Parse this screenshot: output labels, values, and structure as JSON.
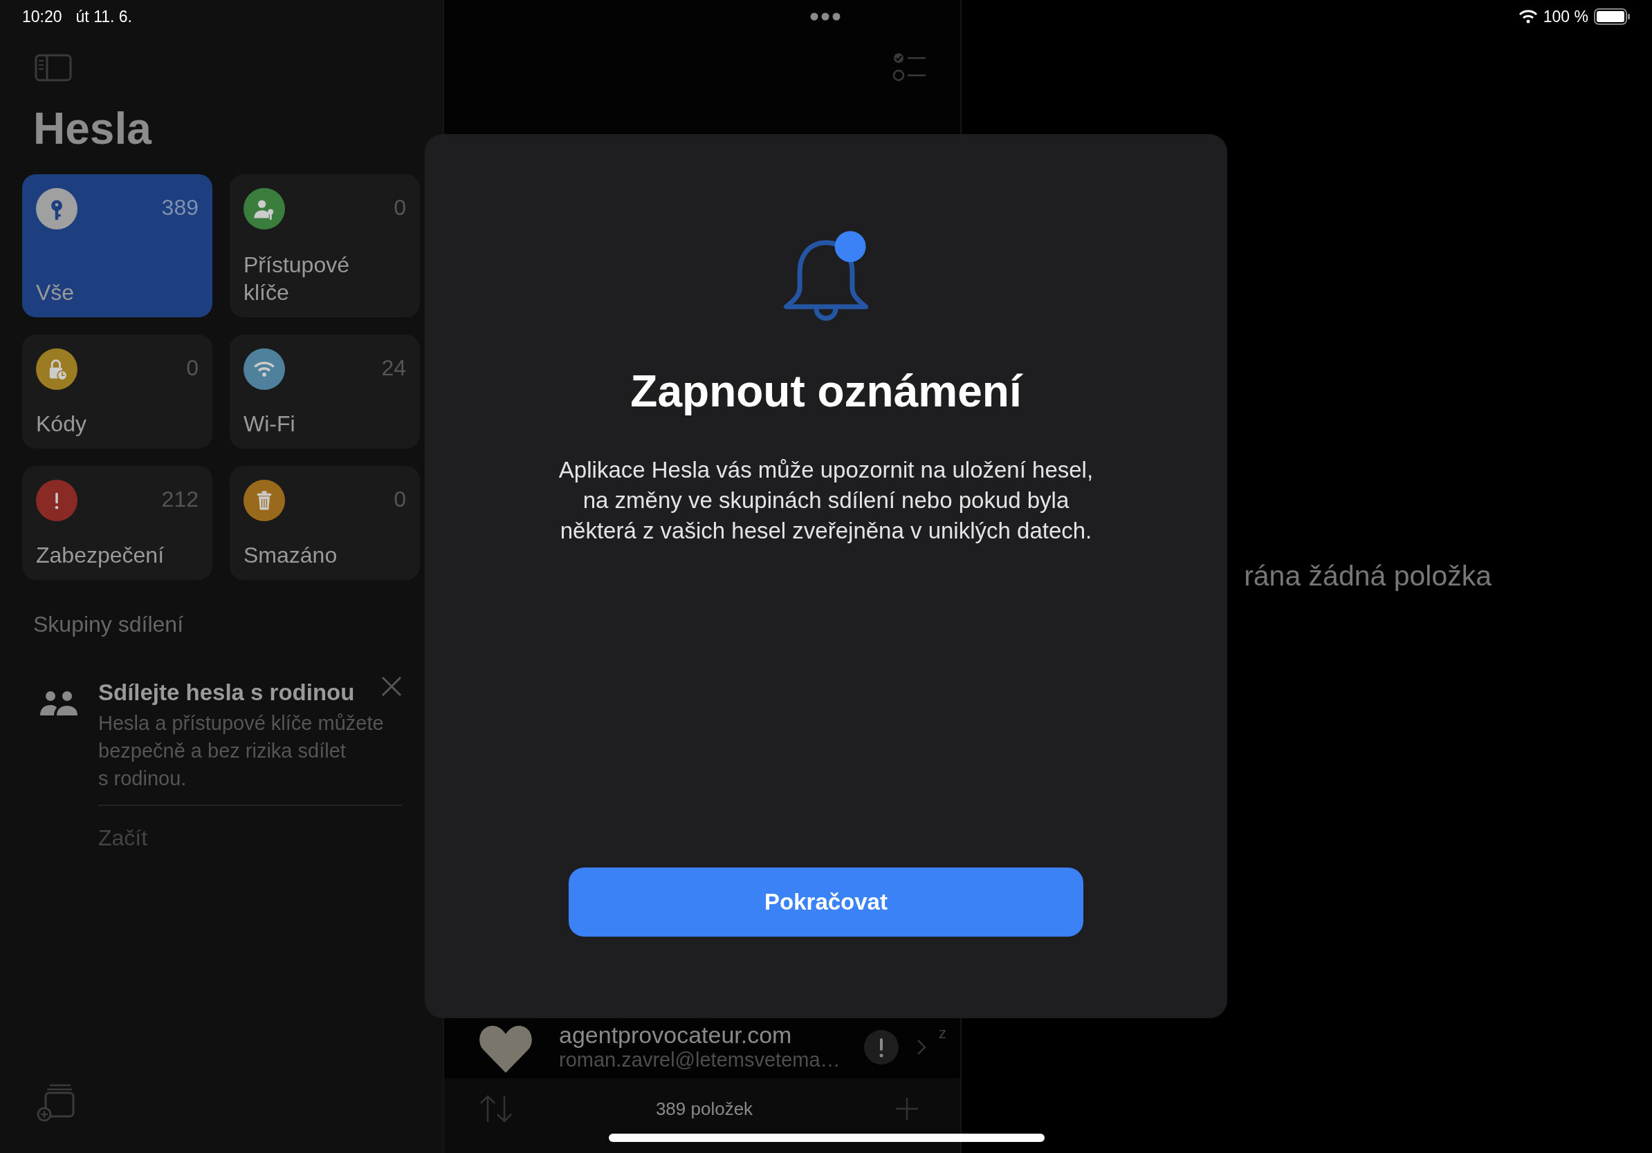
{
  "status_bar": {
    "time": "10:20",
    "date": "út 11. 6.",
    "battery": "100 %"
  },
  "sidebar": {
    "title": "Hesla",
    "categories": [
      {
        "label": "Vše",
        "count": "389",
        "selected": true,
        "color": "#a0a0a0"
      },
      {
        "label": "Přístupové klíče",
        "count": "0",
        "selected": false,
        "color": "#3b7d3c"
      },
      {
        "label": "Kódy",
        "count": "0",
        "selected": false,
        "color": "#9c7c22"
      },
      {
        "label": "Wi-Fi",
        "count": "24",
        "selected": false,
        "color": "#4f819c"
      },
      {
        "label": "Zabezpečení",
        "count": "212",
        "selected": false,
        "color": "#8a2a24"
      },
      {
        "label": "Smazáno",
        "count": "0",
        "selected": false,
        "color": "#9a6a1c"
      }
    ],
    "section_title": "Skupiny sdílení",
    "share_card": {
      "title": "Sdílejte hesla s rodinou",
      "description_lines": [
        "Hesla a přístupové klíče můžete",
        "bezpečně a bez rizika sdílet",
        "s rodinou."
      ],
      "action": "Začít"
    }
  },
  "list": {
    "rows": [
      {
        "title": "agentprovocateur.com",
        "subtitle": "roman.zavrel@letemsvetema…",
        "index_letter": "z"
      }
    ],
    "footer": "389 položek"
  },
  "detail": {
    "empty_text": "rána žádná položka"
  },
  "dialog": {
    "title": "Zapnout oznámení",
    "body_lines": [
      "Aplikace Hesla vás může upozornit na uložení hesel,",
      "na změny ve skupinách sdílení nebo pokud byla",
      "některá z vašich hesel zveřejněna v uniklých datech."
    ],
    "button": "Pokračovat"
  }
}
